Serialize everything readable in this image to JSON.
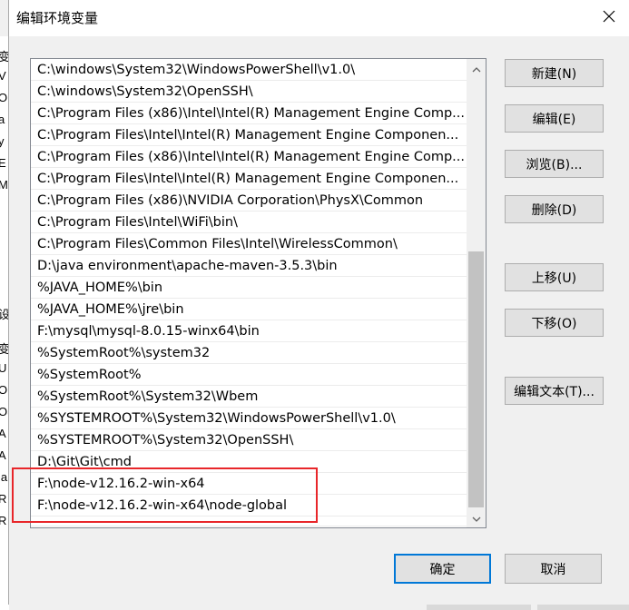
{
  "dialog": {
    "title": "编辑环境变量",
    "close_icon": "close-icon"
  },
  "background_window_fragments": [
    "变",
    "V",
    "Or",
    "a",
    "y",
    "E",
    "M",
    "设",
    "变",
    "U",
    "Or",
    "OS",
    "A",
    "A",
    "la",
    "R",
    "R"
  ],
  "path_list": {
    "items": [
      "C:\\windows\\System32\\WindowsPowerShell\\v1.0\\",
      "C:\\windows\\System32\\OpenSSH\\",
      "C:\\Program Files (x86)\\Intel\\Intel(R) Management Engine Comp...",
      "C:\\Program Files\\Intel\\Intel(R) Management Engine Componen...",
      "C:\\Program Files (x86)\\Intel\\Intel(R) Management Engine Comp...",
      "C:\\Program Files\\Intel\\Intel(R) Management Engine Componen...",
      "C:\\Program Files (x86)\\NVIDIA Corporation\\PhysX\\Common",
      "C:\\Program Files\\Intel\\WiFi\\bin\\",
      "C:\\Program Files\\Common Files\\Intel\\WirelessCommon\\",
      "D:\\java environment\\apache-maven-3.5.3\\bin",
      "%JAVA_HOME%\\bin",
      "%JAVA_HOME%\\jre\\bin",
      "F:\\mysql\\mysql-8.0.15-winx64\\bin",
      "%SystemRoot%\\system32",
      "%SystemRoot%",
      "%SystemRoot%\\System32\\Wbem",
      "%SYSTEMROOT%\\System32\\WindowsPowerShell\\v1.0\\",
      "%SYSTEMROOT%\\System32\\OpenSSH\\",
      "D:\\Git\\Git\\cmd",
      "F:\\node-v12.16.2-win-x64",
      "F:\\node-v12.16.2-win-x64\\node-global"
    ],
    "highlight_color": "#e8262a"
  },
  "buttons": {
    "new": "新建(N)",
    "edit": "编辑(E)",
    "browse": "浏览(B)...",
    "delete": "删除(D)",
    "move_up": "上移(U)",
    "move_down": "下移(O)",
    "edit_text": "编辑文本(T)...",
    "ok": "确定",
    "cancel": "取消"
  },
  "colors": {
    "accent": "#0078d7",
    "highlight": "#e8262a"
  }
}
